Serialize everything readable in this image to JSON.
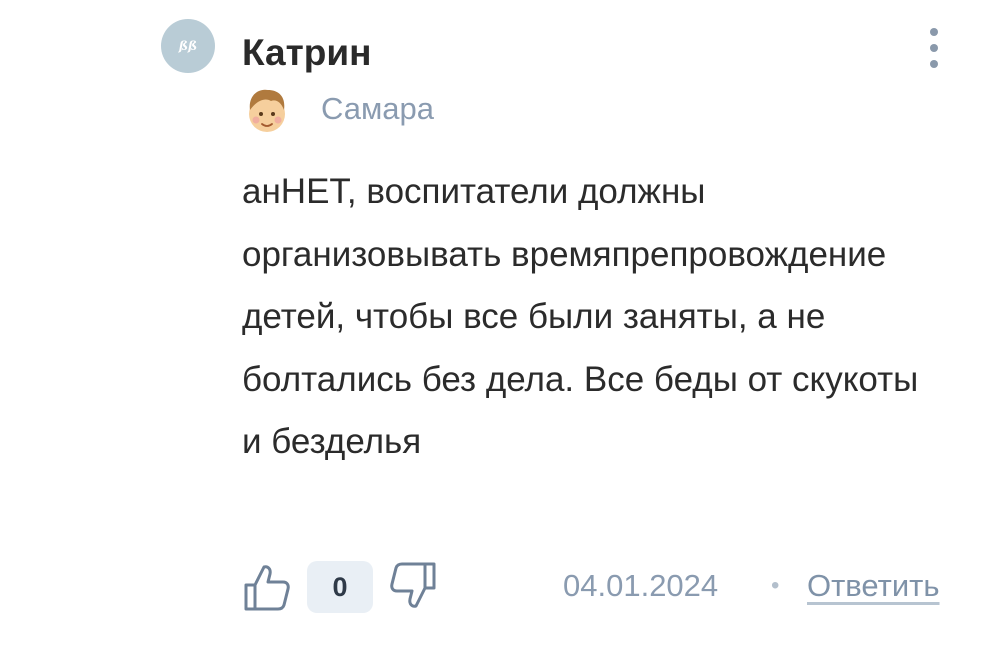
{
  "comment": {
    "avatar_initials": "BB",
    "author": "Катрин",
    "city": "Самара",
    "text": "анНЕТ, воспитатели должны организовывать времяпрепровождение детей, чтобы все были заняты, а не болтались без дела. Все беды от скукоты и безделья",
    "score": "0",
    "date": "04.01.2024",
    "separator": "•",
    "reply_label": "Ответить"
  },
  "icons": {
    "avatar": "avatar-logo-icon",
    "menu": "more-vertical-icon",
    "badge": "user-level-face-icon",
    "like": "thumbs-up-icon",
    "dislike": "thumbs-down-icon"
  },
  "colors": {
    "avatar_bg": "#b9ccd6",
    "muted_text": "#8a9bb0",
    "score_bg": "#e9eff5",
    "icon_stroke": "#6f8197"
  }
}
